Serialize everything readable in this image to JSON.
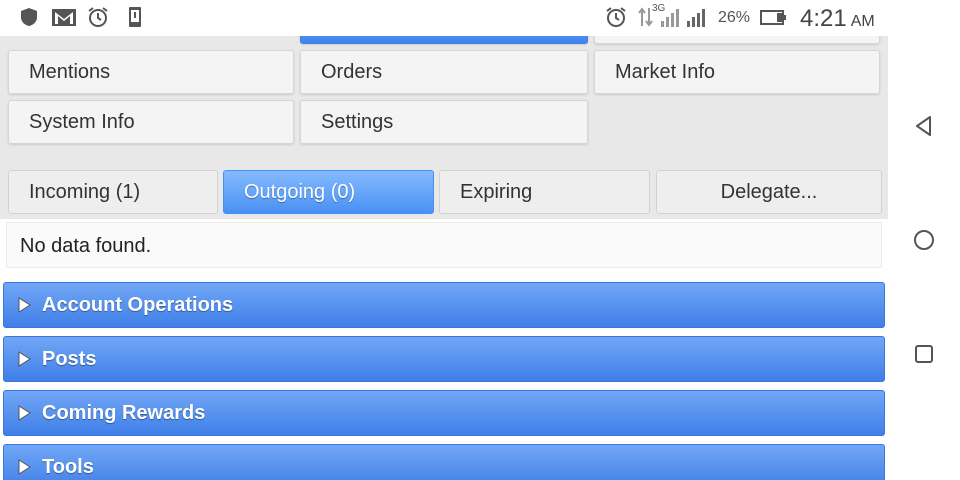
{
  "status_bar": {
    "left_icons": [
      "shield-icon",
      "gmail-icon",
      "alarm-icon",
      "phone-icon"
    ],
    "network_type": "3G",
    "battery_percent": "26%",
    "time": "4:21",
    "ampm": "AM"
  },
  "menu": {
    "buttons": [
      {
        "label": "Mentions"
      },
      {
        "label": "Orders"
      },
      {
        "label": "Market Info"
      },
      {
        "label": "System Info"
      },
      {
        "label": "Settings"
      }
    ]
  },
  "tabs": [
    {
      "label": "Incoming (1)",
      "active": false
    },
    {
      "label": "Outgoing (0)",
      "active": true
    },
    {
      "label": "Expiring",
      "active": false
    },
    {
      "label": "Delegate...",
      "active": false
    }
  ],
  "table": {
    "empty_text": "No data found."
  },
  "sections": [
    {
      "label": "Account Operations"
    },
    {
      "label": "Posts"
    },
    {
      "label": "Coming Rewards"
    },
    {
      "label": "Tools"
    }
  ],
  "colors": {
    "accent": "#4a90f4",
    "section_blue": "#4f8cf0",
    "panel_bg": "#e8e8e8"
  }
}
